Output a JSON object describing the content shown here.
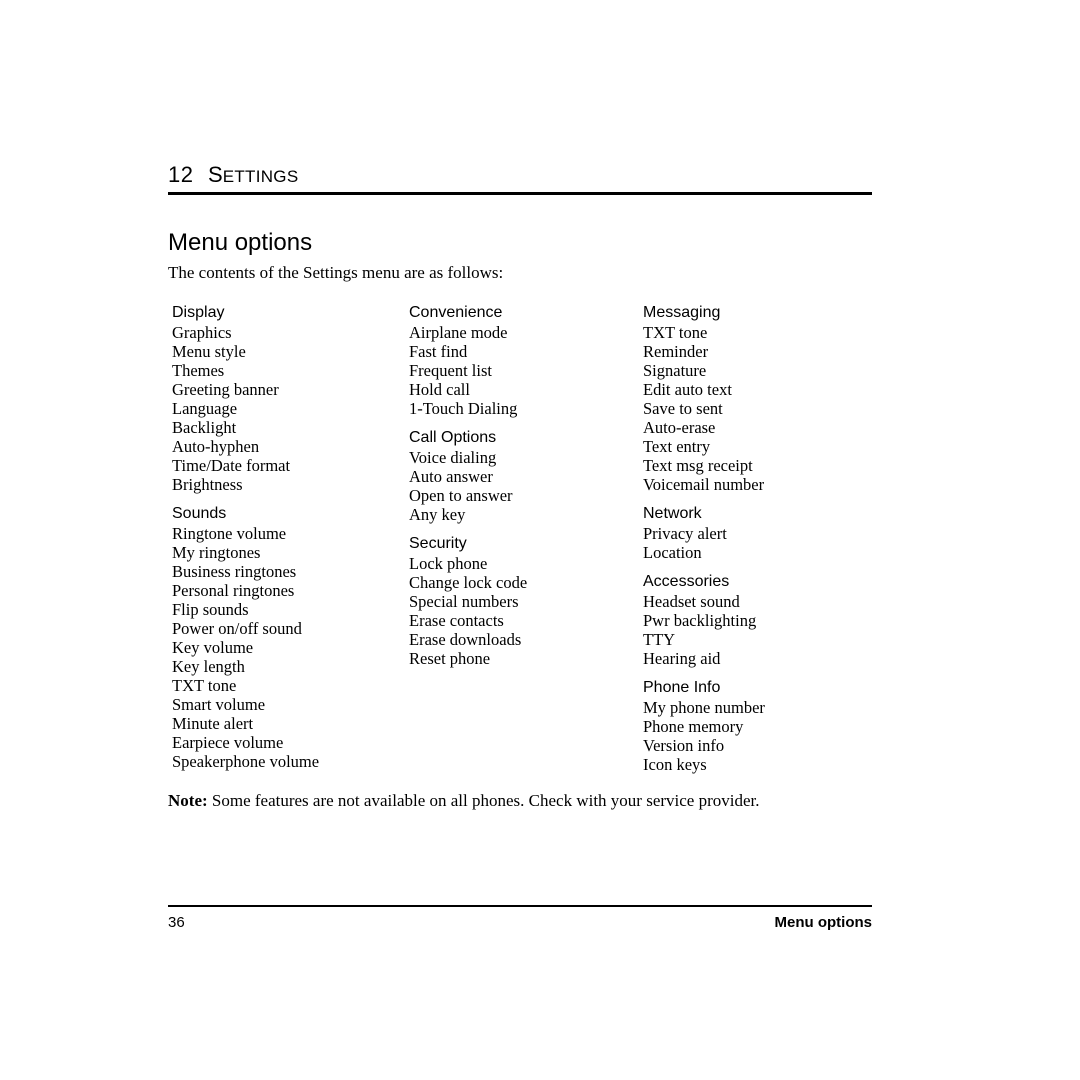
{
  "header": {
    "chapter_number": "12",
    "chapter_title_first": "S",
    "chapter_title_rest": "ETTINGS"
  },
  "section": {
    "title": "Menu options",
    "intro": "The contents of the Settings menu are as follows:"
  },
  "columns": [
    {
      "groups": [
        {
          "heading": "Display",
          "items": [
            "Graphics",
            "Menu style",
            "Themes",
            "Greeting banner",
            "Language",
            "Backlight",
            "Auto-hyphen",
            "Time/Date format",
            "Brightness"
          ]
        },
        {
          "heading": "Sounds",
          "items": [
            "Ringtone volume",
            "My ringtones",
            "Business ringtones",
            "Personal ringtones",
            "Flip sounds",
            "Power on/off sound",
            "Key volume",
            "Key length",
            "TXT tone",
            "Smart volume",
            "Minute alert",
            "Earpiece volume",
            "Speakerphone volume"
          ]
        }
      ]
    },
    {
      "groups": [
        {
          "heading": "Convenience",
          "items": [
            "Airplane mode",
            "Fast find",
            "Frequent list",
            "Hold call",
            "1-Touch Dialing"
          ]
        },
        {
          "heading": "Call Options",
          "items": [
            "Voice dialing",
            "Auto answer",
            "Open to answer",
            "Any key"
          ]
        },
        {
          "heading": "Security",
          "items": [
            "Lock phone",
            "Change lock code",
            "Special numbers",
            "Erase contacts",
            "Erase downloads",
            "Reset phone"
          ]
        }
      ]
    },
    {
      "groups": [
        {
          "heading": "Messaging",
          "items": [
            "TXT tone",
            "Reminder",
            "Signature",
            "Edit auto text",
            "Save to sent",
            "Auto-erase",
            "Text entry",
            "Text msg receipt",
            "Voicemail number"
          ]
        },
        {
          "heading": "Network",
          "items": [
            "Privacy alert",
            "Location"
          ]
        },
        {
          "heading": "Accessories",
          "items": [
            "Headset sound",
            "Pwr backlighting",
            "TTY",
            "Hearing aid"
          ]
        },
        {
          "heading": "Phone Info",
          "items": [
            "My phone number",
            "Phone memory",
            "Version info",
            "Icon keys"
          ]
        }
      ]
    }
  ],
  "note": {
    "label": "Note:",
    "text": "Some features are not available on all phones. Check with your service provider."
  },
  "footer": {
    "page_number": "36",
    "section_label": "Menu options"
  }
}
